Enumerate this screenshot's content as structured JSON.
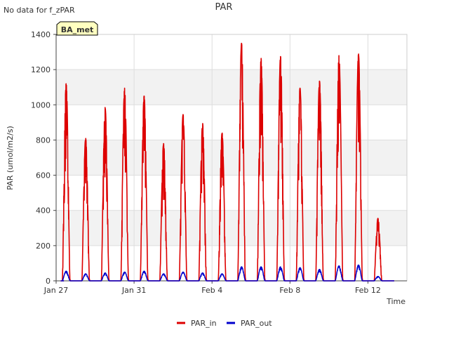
{
  "notice": "No data for f_zPAR",
  "badge": {
    "label": "BA_met",
    "fill": "#ffffc0",
    "text_color": "#990000"
  },
  "chart_data": {
    "type": "line",
    "title": "PAR",
    "xlabel": "Time",
    "ylabel": "PAR (umol/m2/s)",
    "xlim": [
      "2023-01-27",
      "2023-02-14"
    ],
    "ylim": [
      0,
      1400
    ],
    "yticks": [
      0,
      200,
      400,
      600,
      800,
      1000,
      1200,
      1400
    ],
    "xticks": [
      {
        "date": "2023-01-27",
        "label": "Jan 27"
      },
      {
        "date": "2023-01-31",
        "label": "Jan 31"
      },
      {
        "date": "2023-02-04",
        "label": "Feb 4"
      },
      {
        "date": "2023-02-08",
        "label": "Feb 8"
      },
      {
        "date": "2023-02-12",
        "label": "Feb 12"
      }
    ],
    "grid": true,
    "legend_position": "bottom-center",
    "series": [
      {
        "name": "PAR_in",
        "color": "#dd0000",
        "daily_peaks": [
          {
            "date": "2023-01-27",
            "peak": 1120
          },
          {
            "date": "2023-01-28",
            "peak": 810
          },
          {
            "date": "2023-01-29",
            "peak": 985
          },
          {
            "date": "2023-01-30",
            "peak": 1095
          },
          {
            "date": "2023-01-31",
            "peak": 1050
          },
          {
            "date": "2023-02-01",
            "peak": 780
          },
          {
            "date": "2023-02-02",
            "peak": 945
          },
          {
            "date": "2023-02-03",
            "peak": 895
          },
          {
            "date": "2023-02-04",
            "peak": 840
          },
          {
            "date": "2023-02-05",
            "peak": 1350
          },
          {
            "date": "2023-02-06",
            "peak": 1265
          },
          {
            "date": "2023-02-07",
            "peak": 1275
          },
          {
            "date": "2023-02-08",
            "peak": 1095
          },
          {
            "date": "2023-02-09",
            "peak": 1135
          },
          {
            "date": "2023-02-10",
            "peak": 1280
          },
          {
            "date": "2023-02-11",
            "peak": 1290
          },
          {
            "date": "2023-02-12",
            "peak": 355
          }
        ]
      },
      {
        "name": "PAR_out",
        "color": "#0000cc",
        "daily_peaks": [
          {
            "date": "2023-01-27",
            "peak": 55
          },
          {
            "date": "2023-01-28",
            "peak": 40
          },
          {
            "date": "2023-01-29",
            "peak": 45
          },
          {
            "date": "2023-01-30",
            "peak": 50
          },
          {
            "date": "2023-01-31",
            "peak": 55
          },
          {
            "date": "2023-02-01",
            "peak": 40
          },
          {
            "date": "2023-02-02",
            "peak": 50
          },
          {
            "date": "2023-02-03",
            "peak": 45
          },
          {
            "date": "2023-02-04",
            "peak": 40
          },
          {
            "date": "2023-02-05",
            "peak": 80
          },
          {
            "date": "2023-02-06",
            "peak": 80
          },
          {
            "date": "2023-02-07",
            "peak": 80
          },
          {
            "date": "2023-02-08",
            "peak": 75
          },
          {
            "date": "2023-02-09",
            "peak": 65
          },
          {
            "date": "2023-02-10",
            "peak": 85
          },
          {
            "date": "2023-02-11",
            "peak": 90
          },
          {
            "date": "2023-02-12",
            "peak": 25
          }
        ]
      }
    ]
  }
}
